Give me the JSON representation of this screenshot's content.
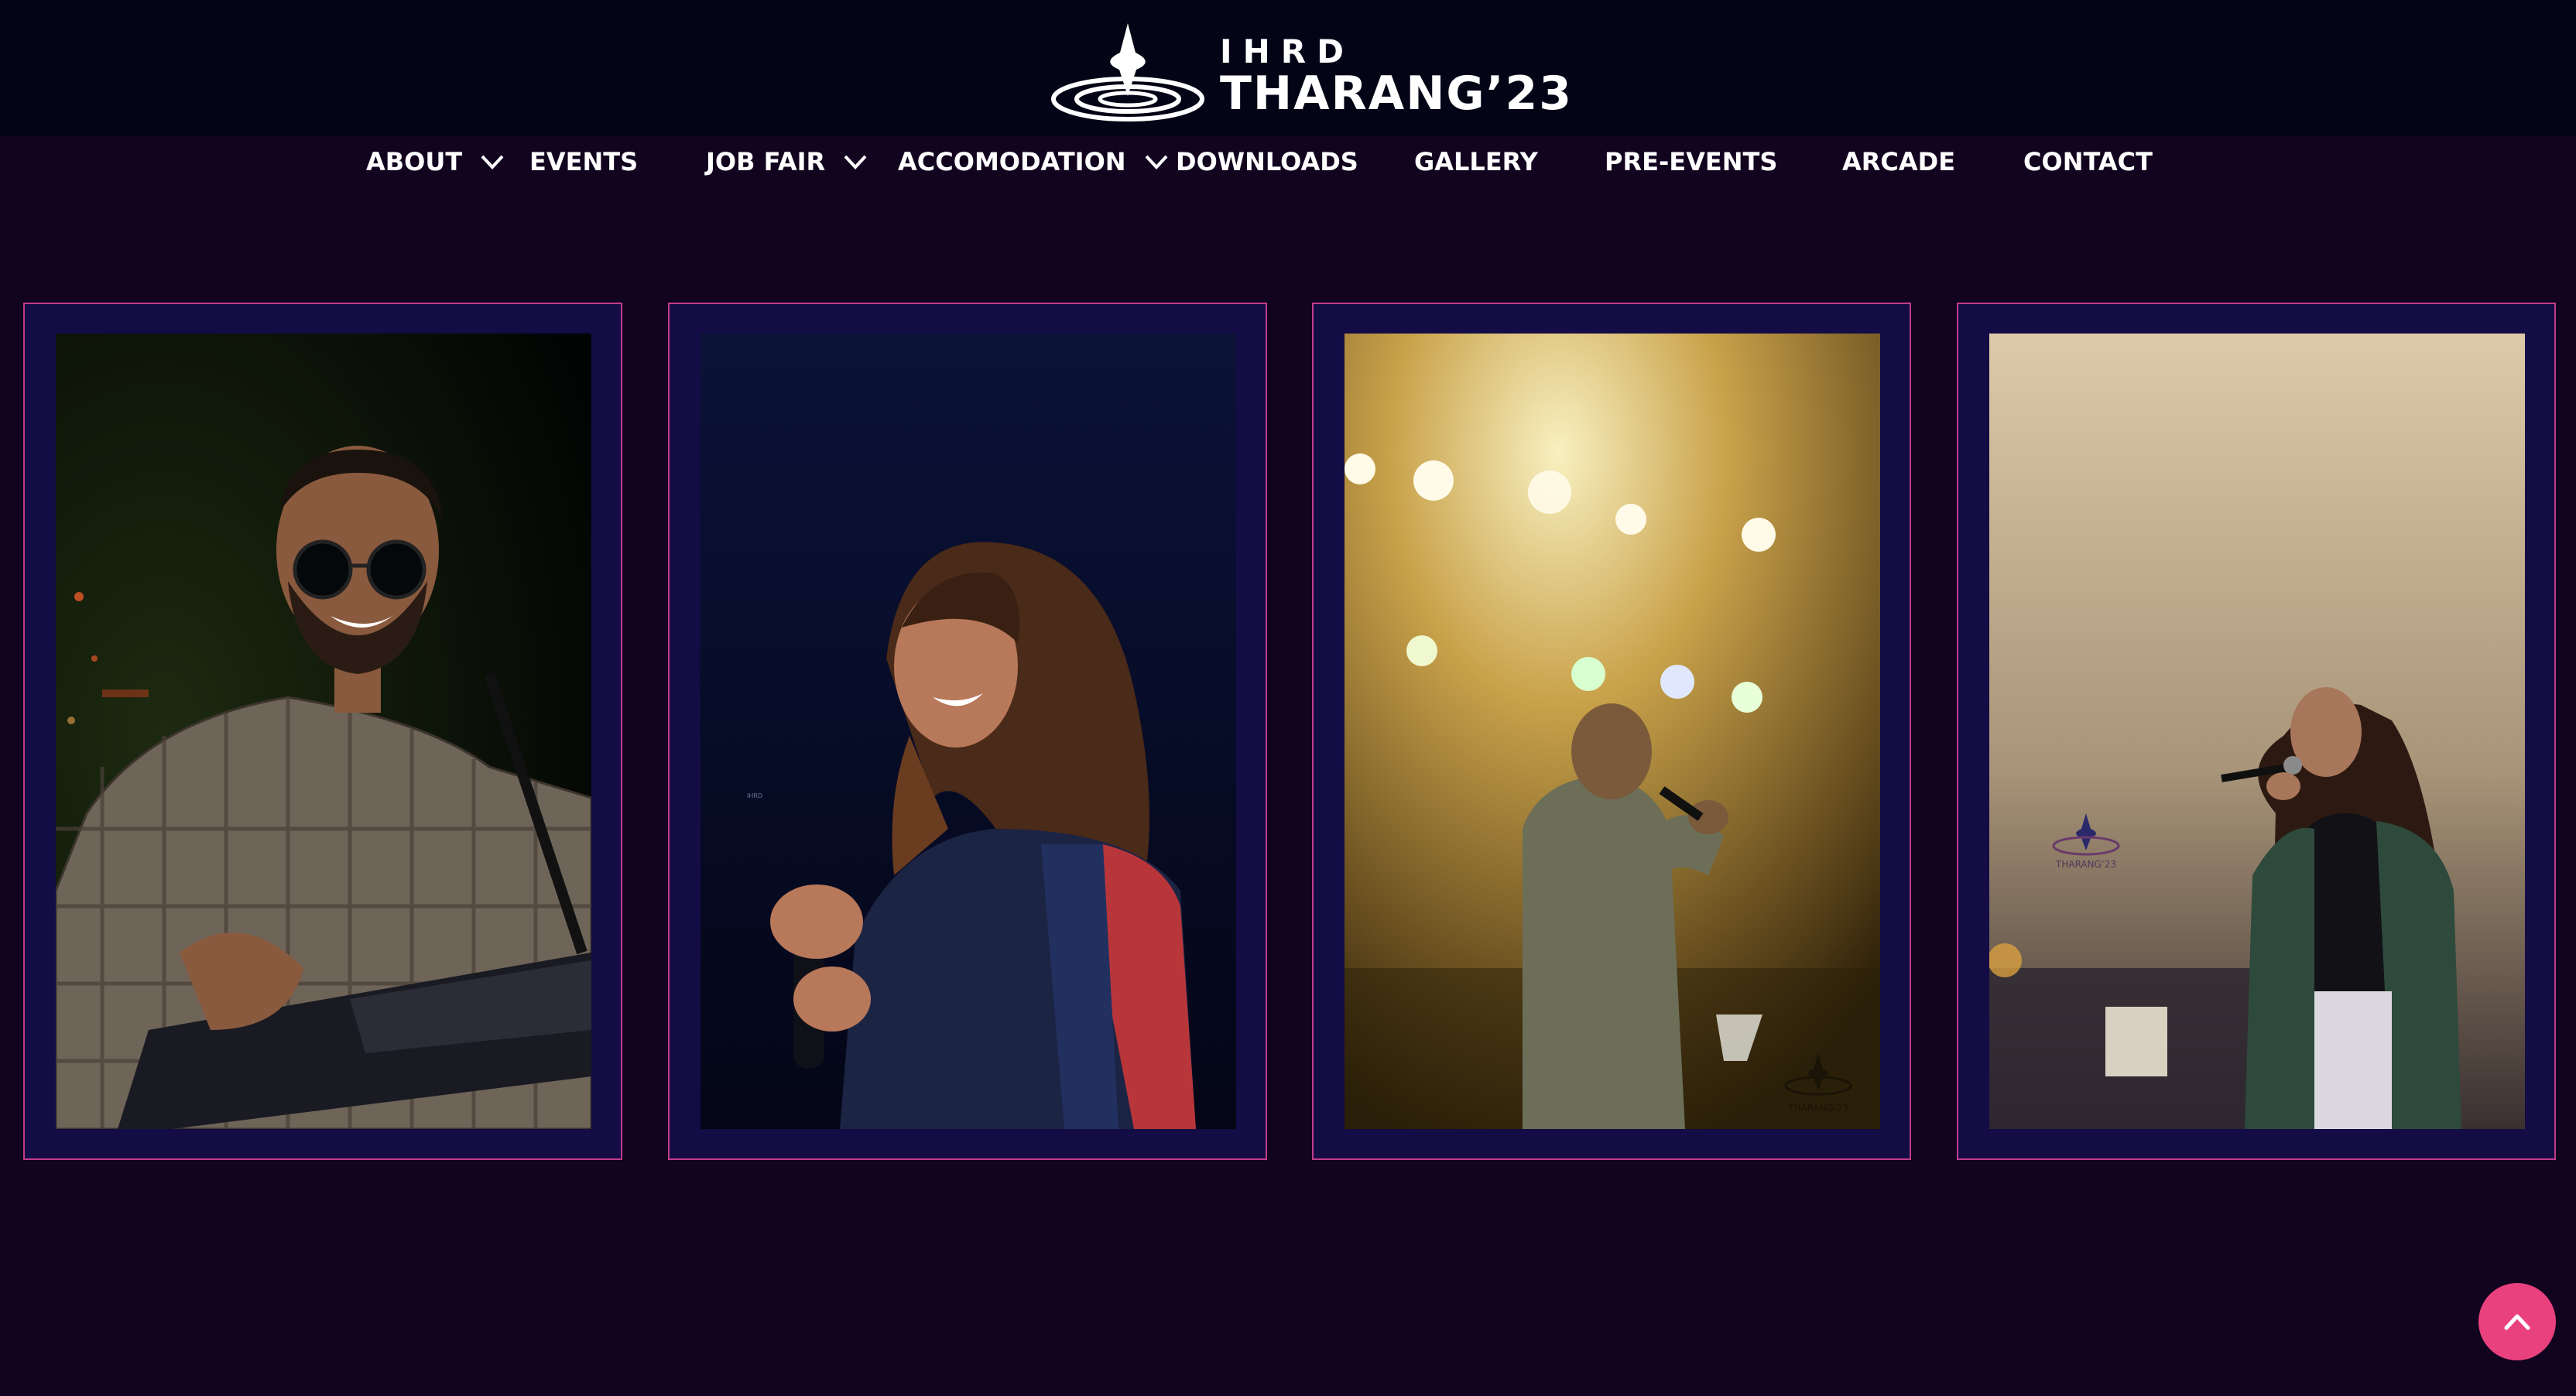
{
  "header": {
    "logo_small": "IHRD",
    "logo_big": "THARANG’23"
  },
  "nav": {
    "items": [
      {
        "label": "ABOUT",
        "has_dropdown": true
      },
      {
        "label": "EVENTS",
        "has_dropdown": false
      },
      {
        "label": "JOB FAIR",
        "has_dropdown": true
      },
      {
        "label": "ACCOMODATION",
        "has_dropdown": true
      },
      {
        "label": "DOWNLOADS",
        "has_dropdown": false
      },
      {
        "label": "GALLERY",
        "has_dropdown": false
      },
      {
        "label": "PRE-EVENTS",
        "has_dropdown": false
      },
      {
        "label": "ARCADE",
        "has_dropdown": false
      },
      {
        "label": "CONTACT",
        "has_dropdown": false
      }
    ]
  },
  "gallery": {
    "items": [
      {
        "subject": "guitarist-with-sunglasses"
      },
      {
        "subject": "female-singer-smiling"
      },
      {
        "subject": "male-singer-stage-lights"
      },
      {
        "subject": "female-singer-smoke"
      }
    ]
  },
  "watermark": {
    "small": "IHRD",
    "big": "THARANG’23"
  },
  "icons": {
    "dropdown": "chevron-down-icon",
    "scroll_top": "chevron-up-icon"
  },
  "colors": {
    "background": "#12031f",
    "header": "#030516",
    "card_bg": "#140c44",
    "card_border": "#c03c8a",
    "accent": "#e8417e"
  }
}
